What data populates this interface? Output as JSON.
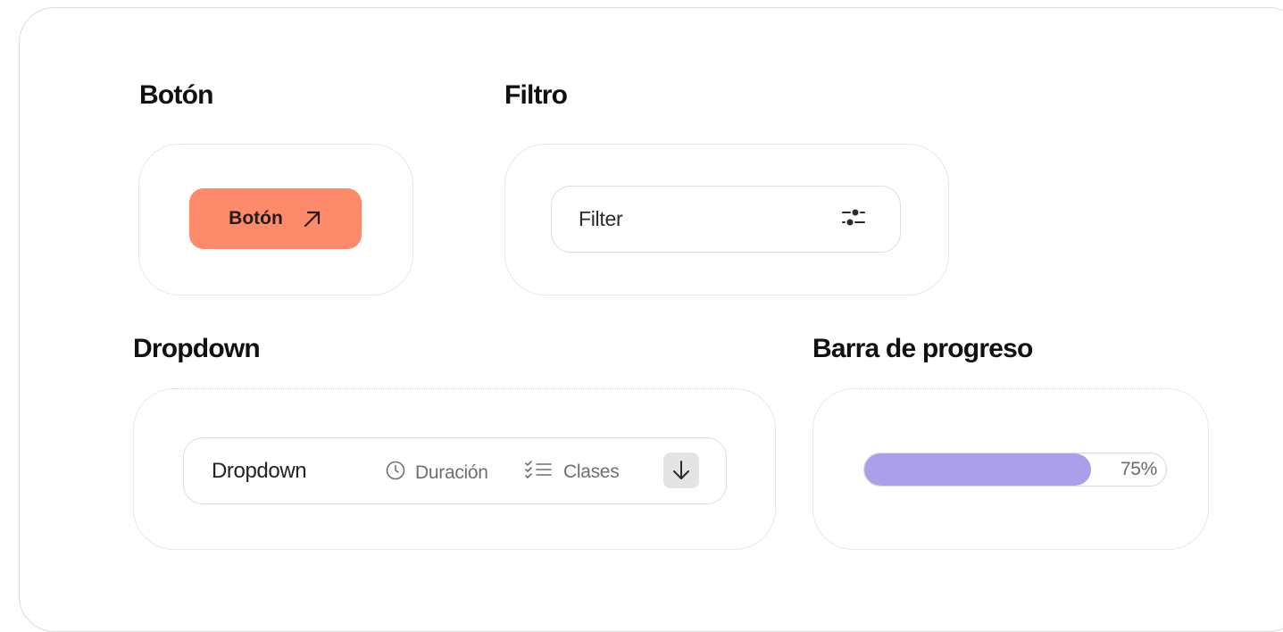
{
  "sections": {
    "button": {
      "title": "Botón"
    },
    "filter": {
      "title": "Filtro"
    },
    "dropdown": {
      "title": "Dropdown"
    },
    "progress": {
      "title": "Barra de progreso"
    }
  },
  "button": {
    "label": "Botón",
    "icon": "arrow-up-right-icon",
    "color": "#fd8a6b"
  },
  "filter": {
    "value": "Filter",
    "icon": "sliders-icon"
  },
  "dropdown": {
    "label": "Dropdown",
    "duration_label": "Duración",
    "duration_icon": "clock-icon",
    "classes_label": "Clases",
    "classes_icon": "list-checks-icon",
    "toggle_icon": "arrow-down-icon"
  },
  "progress": {
    "value": 0.75,
    "label": "75%",
    "color": "#ab9fe9"
  }
}
